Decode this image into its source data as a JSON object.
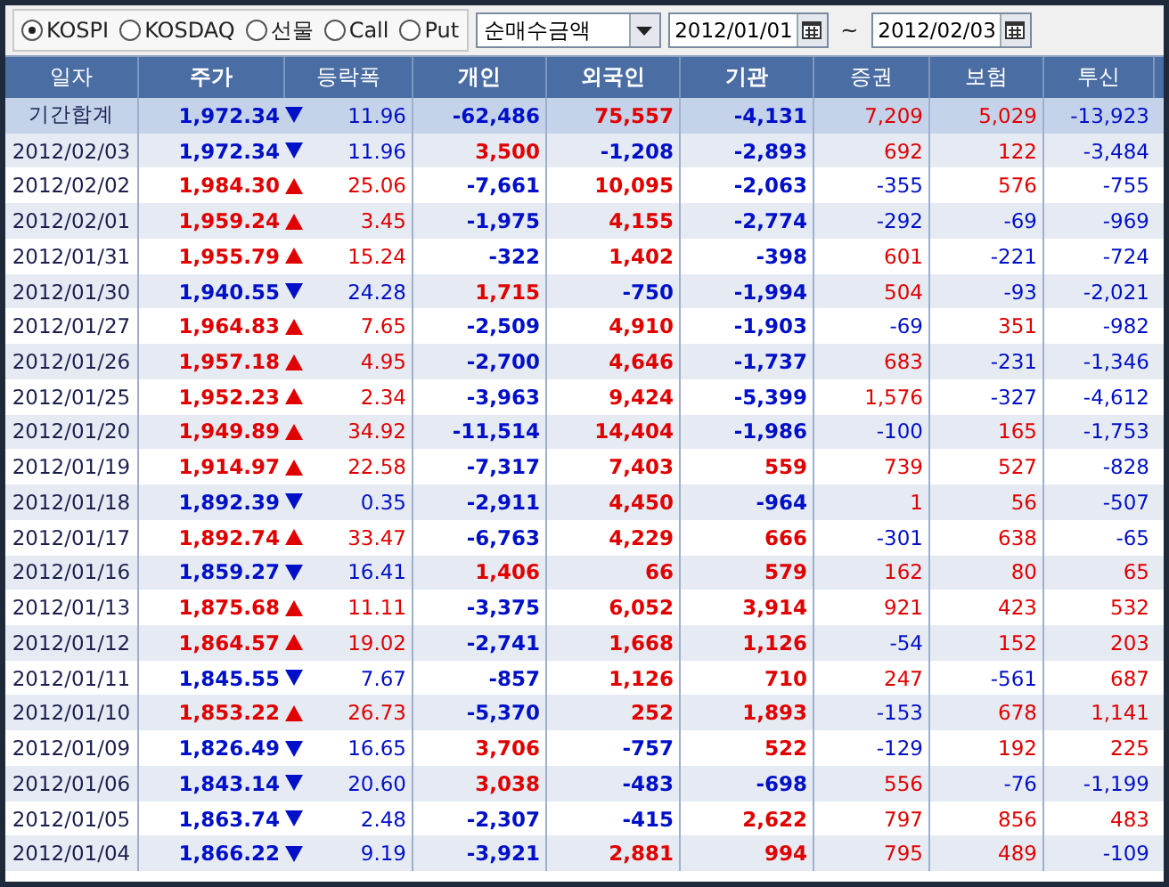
{
  "markets": [
    {
      "label": "KOSPI",
      "selected": true
    },
    {
      "label": "KOSDAQ",
      "selected": false
    },
    {
      "label": "선물",
      "selected": false
    },
    {
      "label": "Call",
      "selected": false
    },
    {
      "label": "Put",
      "selected": false
    }
  ],
  "measure": {
    "value": "순매수금액"
  },
  "date_from": {
    "value": "2012/01/01"
  },
  "range_separator": "~",
  "date_to": {
    "value": "2012/02/03"
  },
  "columns": [
    {
      "label": "일자",
      "emphasized": false
    },
    {
      "label": "주가",
      "emphasized": true
    },
    {
      "label": "등락폭",
      "emphasized": false
    },
    {
      "label": "개인",
      "emphasized": true
    },
    {
      "label": "외국인",
      "emphasized": true
    },
    {
      "label": "기관",
      "emphasized": true
    },
    {
      "label": "증권",
      "emphasized": false
    },
    {
      "label": "보험",
      "emphasized": false
    },
    {
      "label": "투신",
      "emphasized": false
    }
  ],
  "rows": [
    {
      "kind": "total",
      "date": "기간합계",
      "price": "1,972.34",
      "up": false,
      "change": "11.96",
      "individual": "-62,486",
      "foreign": "75,557",
      "institution": "-4,131",
      "securities": "7,209",
      "insurance": "5,029",
      "trust": "-13,923"
    },
    {
      "kind": "day",
      "date": "2012/02/03",
      "price": "1,972.34",
      "up": false,
      "change": "11.96",
      "individual": "3,500",
      "foreign": "-1,208",
      "institution": "-2,893",
      "securities": "692",
      "insurance": "122",
      "trust": "-3,484"
    },
    {
      "kind": "day",
      "date": "2012/02/02",
      "price": "1,984.30",
      "up": true,
      "change": "25.06",
      "individual": "-7,661",
      "foreign": "10,095",
      "institution": "-2,063",
      "securities": "-355",
      "insurance": "576",
      "trust": "-755"
    },
    {
      "kind": "day",
      "date": "2012/02/01",
      "price": "1,959.24",
      "up": true,
      "change": "3.45",
      "individual": "-1,975",
      "foreign": "4,155",
      "institution": "-2,774",
      "securities": "-292",
      "insurance": "-69",
      "trust": "-969"
    },
    {
      "kind": "day",
      "date": "2012/01/31",
      "price": "1,955.79",
      "up": true,
      "change": "15.24",
      "individual": "-322",
      "foreign": "1,402",
      "institution": "-398",
      "securities": "601",
      "insurance": "-221",
      "trust": "-724"
    },
    {
      "kind": "day",
      "date": "2012/01/30",
      "price": "1,940.55",
      "up": false,
      "change": "24.28",
      "individual": "1,715",
      "foreign": "-750",
      "institution": "-1,994",
      "securities": "504",
      "insurance": "-93",
      "trust": "-2,021"
    },
    {
      "kind": "day",
      "date": "2012/01/27",
      "price": "1,964.83",
      "up": true,
      "change": "7.65",
      "individual": "-2,509",
      "foreign": "4,910",
      "institution": "-1,903",
      "securities": "-69",
      "insurance": "351",
      "trust": "-982"
    },
    {
      "kind": "day",
      "date": "2012/01/26",
      "price": "1,957.18",
      "up": true,
      "change": "4.95",
      "individual": "-2,700",
      "foreign": "4,646",
      "institution": "-1,737",
      "securities": "683",
      "insurance": "-231",
      "trust": "-1,346"
    },
    {
      "kind": "day",
      "date": "2012/01/25",
      "price": "1,952.23",
      "up": true,
      "change": "2.34",
      "individual": "-3,963",
      "foreign": "9,424",
      "institution": "-5,399",
      "securities": "1,576",
      "insurance": "-327",
      "trust": "-4,612"
    },
    {
      "kind": "day",
      "date": "2012/01/20",
      "price": "1,949.89",
      "up": true,
      "change": "34.92",
      "individual": "-11,514",
      "foreign": "14,404",
      "institution": "-1,986",
      "securities": "-100",
      "insurance": "165",
      "trust": "-1,753"
    },
    {
      "kind": "day",
      "date": "2012/01/19",
      "price": "1,914.97",
      "up": true,
      "change": "22.58",
      "individual": "-7,317",
      "foreign": "7,403",
      "institution": "559",
      "securities": "739",
      "insurance": "527",
      "trust": "-828"
    },
    {
      "kind": "day",
      "date": "2012/01/18",
      "price": "1,892.39",
      "up": false,
      "change": "0.35",
      "individual": "-2,911",
      "foreign": "4,450",
      "institution": "-964",
      "securities": "1",
      "insurance": "56",
      "trust": "-507"
    },
    {
      "kind": "day",
      "date": "2012/01/17",
      "price": "1,892.74",
      "up": true,
      "change": "33.47",
      "individual": "-6,763",
      "foreign": "4,229",
      "institution": "666",
      "securities": "-301",
      "insurance": "638",
      "trust": "-65"
    },
    {
      "kind": "day",
      "date": "2012/01/16",
      "price": "1,859.27",
      "up": false,
      "change": "16.41",
      "individual": "1,406",
      "foreign": "66",
      "institution": "579",
      "securities": "162",
      "insurance": "80",
      "trust": "65"
    },
    {
      "kind": "day",
      "date": "2012/01/13",
      "price": "1,875.68",
      "up": true,
      "change": "11.11",
      "individual": "-3,375",
      "foreign": "6,052",
      "institution": "3,914",
      "securities": "921",
      "insurance": "423",
      "trust": "532"
    },
    {
      "kind": "day",
      "date": "2012/01/12",
      "price": "1,864.57",
      "up": true,
      "change": "19.02",
      "individual": "-2,741",
      "foreign": "1,668",
      "institution": "1,126",
      "securities": "-54",
      "insurance": "152",
      "trust": "203"
    },
    {
      "kind": "day",
      "date": "2012/01/11",
      "price": "1,845.55",
      "up": false,
      "change": "7.67",
      "individual": "-857",
      "foreign": "1,126",
      "institution": "710",
      "securities": "247",
      "insurance": "-561",
      "trust": "687"
    },
    {
      "kind": "day",
      "date": "2012/01/10",
      "price": "1,853.22",
      "up": true,
      "change": "26.73",
      "individual": "-5,370",
      "foreign": "252",
      "institution": "1,893",
      "securities": "-153",
      "insurance": "678",
      "trust": "1,141"
    },
    {
      "kind": "day",
      "date": "2012/01/09",
      "price": "1,826.49",
      "up": false,
      "change": "16.65",
      "individual": "3,706",
      "foreign": "-757",
      "institution": "522",
      "securities": "-129",
      "insurance": "192",
      "trust": "225"
    },
    {
      "kind": "day",
      "date": "2012/01/06",
      "price": "1,843.14",
      "up": false,
      "change": "20.60",
      "individual": "3,038",
      "foreign": "-483",
      "institution": "-698",
      "securities": "556",
      "insurance": "-76",
      "trust": "-1,199"
    },
    {
      "kind": "day",
      "date": "2012/01/05",
      "price": "1,863.74",
      "up": false,
      "change": "2.48",
      "individual": "-2,307",
      "foreign": "-415",
      "institution": "2,622",
      "securities": "797",
      "insurance": "856",
      "trust": "483"
    },
    {
      "kind": "day",
      "date": "2012/01/04",
      "price": "1,866.22",
      "up": false,
      "change": "9.19",
      "individual": "-3,921",
      "foreign": "2,881",
      "institution": "994",
      "securities": "795",
      "insurance": "489",
      "trust": "-109"
    }
  ]
}
